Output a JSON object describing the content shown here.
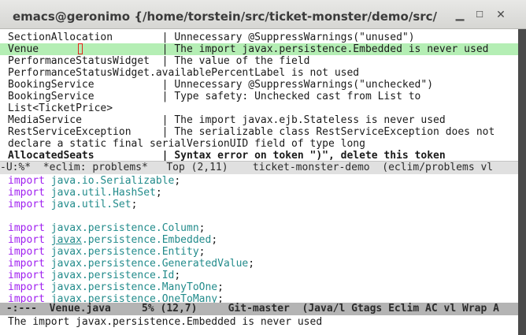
{
  "window": {
    "title": "emacs@geronimo {/home/torstein/src/ticket-monster/demo/src/main/java...",
    "min_icon": "minimize-icon",
    "max_icon": "maximize-icon",
    "close_icon": "close-icon"
  },
  "problems": [
    {
      "text": "SectionAllocation        | Unnecessary @SuppressWarnings(\"unused\")"
    },
    {
      "text": "Venue                    | The import javax.persistence.Embedded is never used"
    },
    {
      "text": "PerformanceStatusWidget  | The value of the field"
    },
    {
      "text": "PerformanceStatusWidget.availablePercentLabel is not used"
    },
    {
      "text": "BookingService           | Unnecessary @SuppressWarnings(\"unchecked\")"
    },
    {
      "text": "BookingService           | Type safety: Unchecked cast from List to"
    },
    {
      "text": "List<TicketPrice>"
    },
    {
      "text": "MediaService             | The import javax.ejb.Stateless is never used"
    },
    {
      "text": "RestServiceException     | The serializable class RestServiceException does not"
    },
    {
      "text": "declare a static final serialVersionUID field of type long"
    },
    {
      "text": "AllocatedSeats           | Syntax error on token \")\", delete this token"
    }
  ],
  "modeline_top": "-U:%*  *eclim: problems*   Top (2,11)    ticket-monster-demo  (eclim/problems vl",
  "code": [
    {
      "kw": "import",
      "pkg": "java",
      "rest1": ".io.",
      "cls": "Serializable",
      "end": ";"
    },
    {
      "kw": "import",
      "pkg": "java",
      "rest1": ".util.",
      "cls": "HashSet",
      "end": ";"
    },
    {
      "kw": "import",
      "pkg": "java",
      "rest1": ".util.",
      "cls": "Set",
      "end": ";"
    },
    {
      "kw": "",
      "pkg": "",
      "rest1": "",
      "cls": "",
      "end": ""
    },
    {
      "kw": "import",
      "pkg": "javax",
      "rest1": ".persistence.",
      "cls": "Column",
      "end": ";"
    },
    {
      "kw": "import",
      "pkg": "javax",
      "rest1": ".persistence.",
      "cls": "Embedded",
      "end": ";"
    },
    {
      "kw": "import",
      "pkg": "javax",
      "rest1": ".persistence.",
      "cls": "Entity",
      "end": ";"
    },
    {
      "kw": "import",
      "pkg": "javax",
      "rest1": ".persistence.",
      "cls": "GeneratedValue",
      "end": ";"
    },
    {
      "kw": "import",
      "pkg": "javax",
      "rest1": ".persistence.",
      "cls": "Id",
      "end": ";"
    },
    {
      "kw": "import",
      "pkg": "javax",
      "rest1": ".persistence.",
      "cls": "ManyToOne",
      "end": ";"
    },
    {
      "kw": "import",
      "pkg": "javax",
      "rest1": ".persistence.",
      "cls": "OneToMany",
      "end": ";"
    }
  ],
  "modeline_bottom": " -:---  Venue.java     5% (12,7)     Git-master  (Java/l Gtags Eclim AC vl Wrap A",
  "minibuffer": "The import javax.persistence.Embedded is never used",
  "colors": {
    "highlight": "#b4eeb4",
    "keyword": "#a020f0",
    "package": "#228b8b"
  }
}
